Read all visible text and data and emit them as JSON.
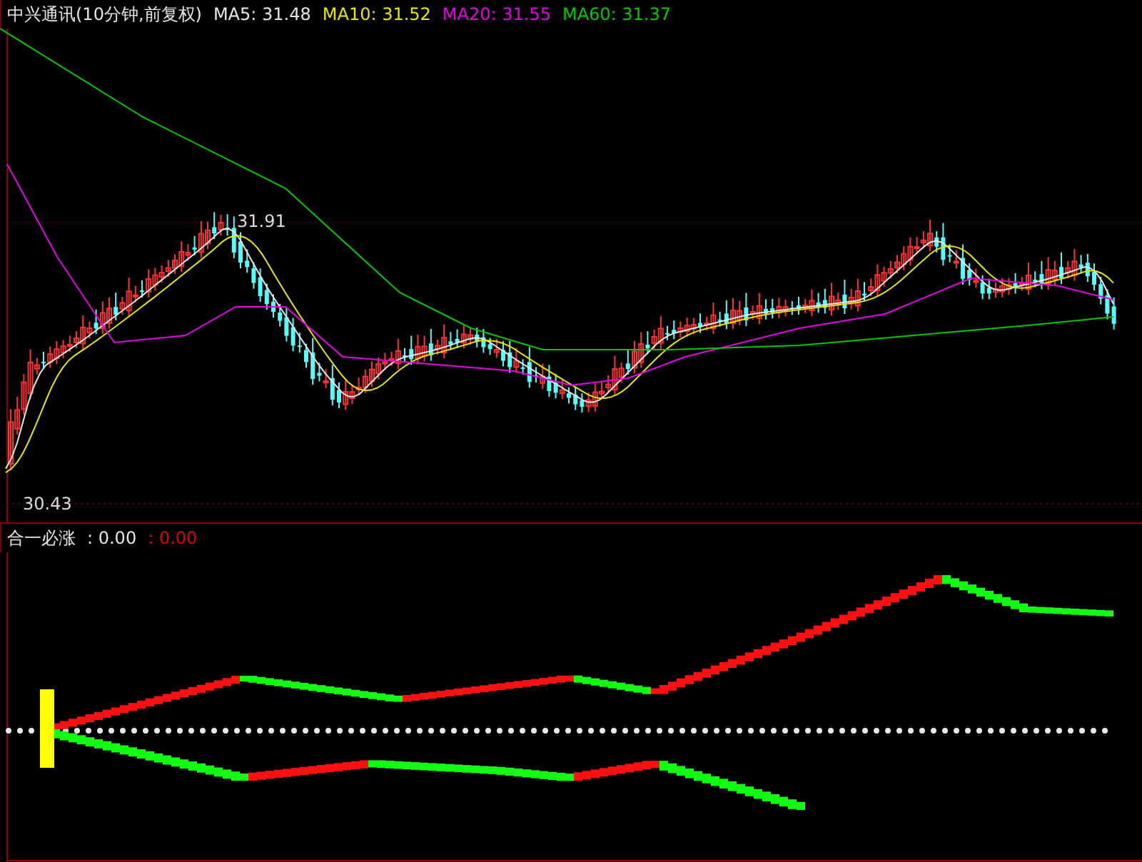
{
  "price_pane": {
    "title": "中兴通讯(10分钟,前复权)",
    "moving_averages": [
      {
        "label": "MA5: 31.48",
        "color": "#e6e6e6"
      },
      {
        "label": "MA10: 31.52",
        "color": "#e6e600"
      },
      {
        "label": "MA20: 31.55",
        "color": "#e600e6"
      },
      {
        "label": "MA60: 31.37",
        "color": "#00c800"
      }
    ],
    "high_label": "31.91",
    "low_label": "30.43"
  },
  "indicator_pane": {
    "name": "合一必涨",
    "values": [
      {
        "label": ": 0.00",
        "color": "#e6e6e6"
      },
      {
        "label": ": 0.00",
        "color": "#e00000"
      }
    ]
  }
}
